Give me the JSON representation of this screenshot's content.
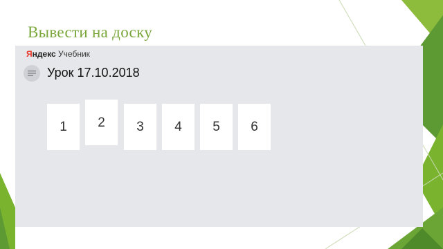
{
  "slide": {
    "title": "Вывести на доску"
  },
  "app": {
    "brand_logo_first": "Я",
    "brand_logo_rest": "ндекс",
    "brand_product": "Учебник",
    "menu_icon": "menu-lines-icon"
  },
  "lesson": {
    "title": "Урок 17.10.2018"
  },
  "pages": [
    {
      "label": "1",
      "raised": false
    },
    {
      "label": "2",
      "raised": true
    },
    {
      "label": "3",
      "raised": false
    },
    {
      "label": "4",
      "raised": false
    },
    {
      "label": "5",
      "raised": false
    },
    {
      "label": "6",
      "raised": false
    }
  ],
  "colors": {
    "title": "#7aa63b",
    "accent_green": "#7ab32e",
    "accent_dark_green": "#4f8a2a",
    "panel_bg": "#e6e7ea"
  }
}
